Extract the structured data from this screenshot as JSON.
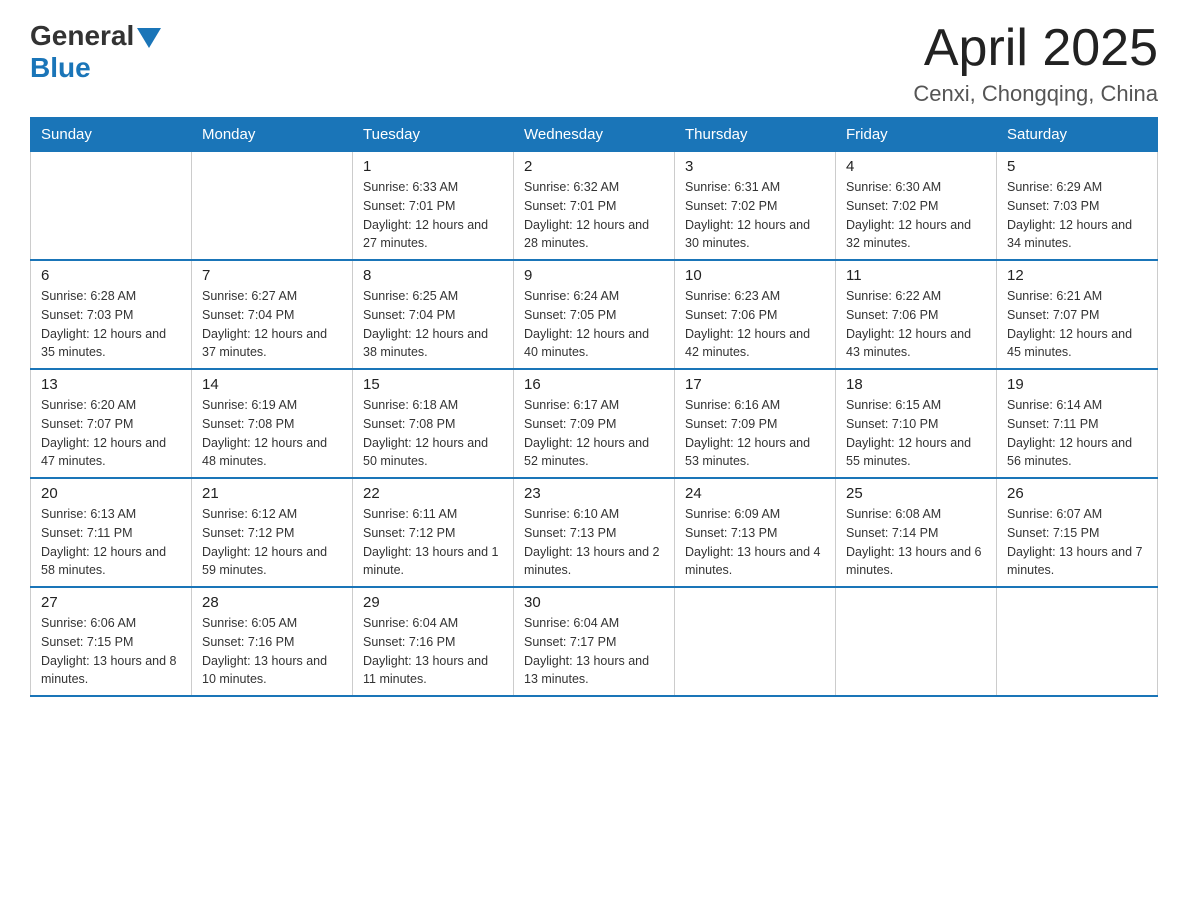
{
  "logo": {
    "general": "General",
    "blue": "Blue"
  },
  "header": {
    "month_year": "April 2025",
    "location": "Cenxi, Chongqing, China"
  },
  "weekdays": [
    "Sunday",
    "Monday",
    "Tuesday",
    "Wednesday",
    "Thursday",
    "Friday",
    "Saturday"
  ],
  "weeks": [
    [
      {
        "day": "",
        "sunrise": "",
        "sunset": "",
        "daylight": ""
      },
      {
        "day": "",
        "sunrise": "",
        "sunset": "",
        "daylight": ""
      },
      {
        "day": "1",
        "sunrise": "Sunrise: 6:33 AM",
        "sunset": "Sunset: 7:01 PM",
        "daylight": "Daylight: 12 hours and 27 minutes."
      },
      {
        "day": "2",
        "sunrise": "Sunrise: 6:32 AM",
        "sunset": "Sunset: 7:01 PM",
        "daylight": "Daylight: 12 hours and 28 minutes."
      },
      {
        "day": "3",
        "sunrise": "Sunrise: 6:31 AM",
        "sunset": "Sunset: 7:02 PM",
        "daylight": "Daylight: 12 hours and 30 minutes."
      },
      {
        "day": "4",
        "sunrise": "Sunrise: 6:30 AM",
        "sunset": "Sunset: 7:02 PM",
        "daylight": "Daylight: 12 hours and 32 minutes."
      },
      {
        "day": "5",
        "sunrise": "Sunrise: 6:29 AM",
        "sunset": "Sunset: 7:03 PM",
        "daylight": "Daylight: 12 hours and 34 minutes."
      }
    ],
    [
      {
        "day": "6",
        "sunrise": "Sunrise: 6:28 AM",
        "sunset": "Sunset: 7:03 PM",
        "daylight": "Daylight: 12 hours and 35 minutes."
      },
      {
        "day": "7",
        "sunrise": "Sunrise: 6:27 AM",
        "sunset": "Sunset: 7:04 PM",
        "daylight": "Daylight: 12 hours and 37 minutes."
      },
      {
        "day": "8",
        "sunrise": "Sunrise: 6:25 AM",
        "sunset": "Sunset: 7:04 PM",
        "daylight": "Daylight: 12 hours and 38 minutes."
      },
      {
        "day": "9",
        "sunrise": "Sunrise: 6:24 AM",
        "sunset": "Sunset: 7:05 PM",
        "daylight": "Daylight: 12 hours and 40 minutes."
      },
      {
        "day": "10",
        "sunrise": "Sunrise: 6:23 AM",
        "sunset": "Sunset: 7:06 PM",
        "daylight": "Daylight: 12 hours and 42 minutes."
      },
      {
        "day": "11",
        "sunrise": "Sunrise: 6:22 AM",
        "sunset": "Sunset: 7:06 PM",
        "daylight": "Daylight: 12 hours and 43 minutes."
      },
      {
        "day": "12",
        "sunrise": "Sunrise: 6:21 AM",
        "sunset": "Sunset: 7:07 PM",
        "daylight": "Daylight: 12 hours and 45 minutes."
      }
    ],
    [
      {
        "day": "13",
        "sunrise": "Sunrise: 6:20 AM",
        "sunset": "Sunset: 7:07 PM",
        "daylight": "Daylight: 12 hours and 47 minutes."
      },
      {
        "day": "14",
        "sunrise": "Sunrise: 6:19 AM",
        "sunset": "Sunset: 7:08 PM",
        "daylight": "Daylight: 12 hours and 48 minutes."
      },
      {
        "day": "15",
        "sunrise": "Sunrise: 6:18 AM",
        "sunset": "Sunset: 7:08 PM",
        "daylight": "Daylight: 12 hours and 50 minutes."
      },
      {
        "day": "16",
        "sunrise": "Sunrise: 6:17 AM",
        "sunset": "Sunset: 7:09 PM",
        "daylight": "Daylight: 12 hours and 52 minutes."
      },
      {
        "day": "17",
        "sunrise": "Sunrise: 6:16 AM",
        "sunset": "Sunset: 7:09 PM",
        "daylight": "Daylight: 12 hours and 53 minutes."
      },
      {
        "day": "18",
        "sunrise": "Sunrise: 6:15 AM",
        "sunset": "Sunset: 7:10 PM",
        "daylight": "Daylight: 12 hours and 55 minutes."
      },
      {
        "day": "19",
        "sunrise": "Sunrise: 6:14 AM",
        "sunset": "Sunset: 7:11 PM",
        "daylight": "Daylight: 12 hours and 56 minutes."
      }
    ],
    [
      {
        "day": "20",
        "sunrise": "Sunrise: 6:13 AM",
        "sunset": "Sunset: 7:11 PM",
        "daylight": "Daylight: 12 hours and 58 minutes."
      },
      {
        "day": "21",
        "sunrise": "Sunrise: 6:12 AM",
        "sunset": "Sunset: 7:12 PM",
        "daylight": "Daylight: 12 hours and 59 minutes."
      },
      {
        "day": "22",
        "sunrise": "Sunrise: 6:11 AM",
        "sunset": "Sunset: 7:12 PM",
        "daylight": "Daylight: 13 hours and 1 minute."
      },
      {
        "day": "23",
        "sunrise": "Sunrise: 6:10 AM",
        "sunset": "Sunset: 7:13 PM",
        "daylight": "Daylight: 13 hours and 2 minutes."
      },
      {
        "day": "24",
        "sunrise": "Sunrise: 6:09 AM",
        "sunset": "Sunset: 7:13 PM",
        "daylight": "Daylight: 13 hours and 4 minutes."
      },
      {
        "day": "25",
        "sunrise": "Sunrise: 6:08 AM",
        "sunset": "Sunset: 7:14 PM",
        "daylight": "Daylight: 13 hours and 6 minutes."
      },
      {
        "day": "26",
        "sunrise": "Sunrise: 6:07 AM",
        "sunset": "Sunset: 7:15 PM",
        "daylight": "Daylight: 13 hours and 7 minutes."
      }
    ],
    [
      {
        "day": "27",
        "sunrise": "Sunrise: 6:06 AM",
        "sunset": "Sunset: 7:15 PM",
        "daylight": "Daylight: 13 hours and 8 minutes."
      },
      {
        "day": "28",
        "sunrise": "Sunrise: 6:05 AM",
        "sunset": "Sunset: 7:16 PM",
        "daylight": "Daylight: 13 hours and 10 minutes."
      },
      {
        "day": "29",
        "sunrise": "Sunrise: 6:04 AM",
        "sunset": "Sunset: 7:16 PM",
        "daylight": "Daylight: 13 hours and 11 minutes."
      },
      {
        "day": "30",
        "sunrise": "Sunrise: 6:04 AM",
        "sunset": "Sunset: 7:17 PM",
        "daylight": "Daylight: 13 hours and 13 minutes."
      },
      {
        "day": "",
        "sunrise": "",
        "sunset": "",
        "daylight": ""
      },
      {
        "day": "",
        "sunrise": "",
        "sunset": "",
        "daylight": ""
      },
      {
        "day": "",
        "sunrise": "",
        "sunset": "",
        "daylight": ""
      }
    ]
  ]
}
